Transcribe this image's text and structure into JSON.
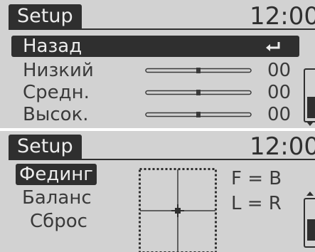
{
  "equalizer_screen": {
    "title": "Setup",
    "clock": "12:00",
    "back_label": "Назад",
    "bands": [
      {
        "label": "Низкий",
        "value": "00",
        "level": 0.5
      },
      {
        "label": "Средн.",
        "value": "00",
        "level": 0.5
      },
      {
        "label": "Высок.",
        "value": "00",
        "level": 0.5
      }
    ]
  },
  "fader_screen": {
    "title": "Setup",
    "clock": "12:00",
    "menu": [
      "Фединг",
      "Баланс",
      "Сброс"
    ],
    "fade_readout": "F = B",
    "balance_readout": "L = R"
  },
  "icons": [
    "back-arrow-icon",
    "scroll-up-arrow-icon",
    "scroll-down-arrow-icon",
    "crosshair-icon"
  ],
  "colors": {
    "screen_bg": "#d2d2d2",
    "dark": "#2f2f2f",
    "text": "#3a3a3a"
  }
}
